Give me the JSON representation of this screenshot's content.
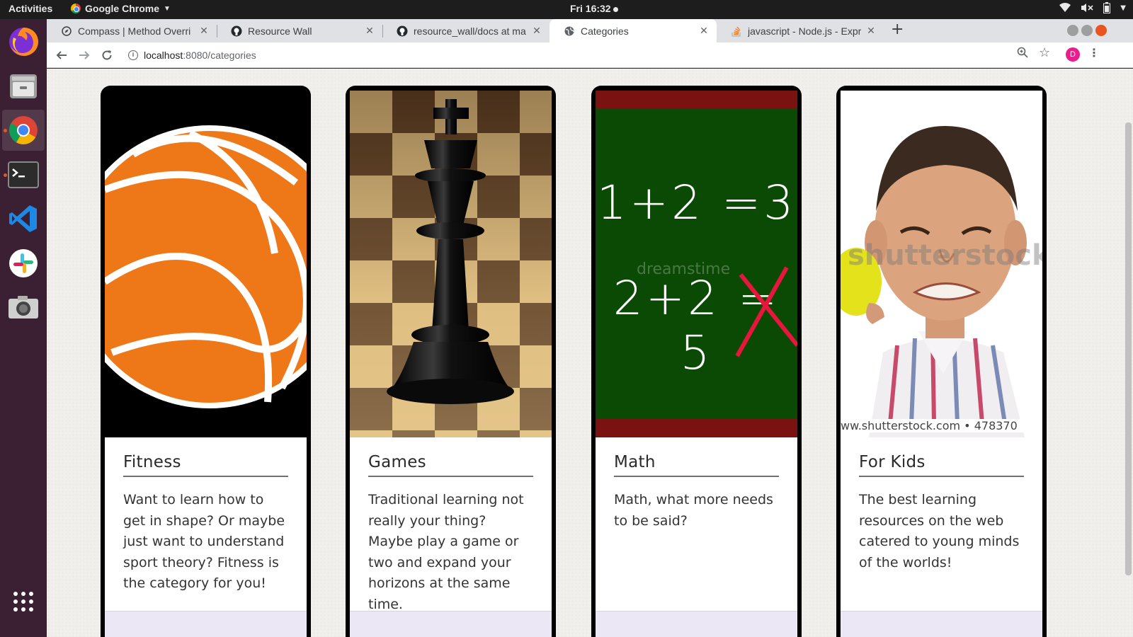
{
  "system": {
    "activities": "Activities",
    "app_name": "Google Chrome",
    "clock": "Fri 16:32"
  },
  "dock": {
    "apps": [
      "firefox-icon",
      "files-icon",
      "chrome-icon",
      "terminal-icon",
      "vscode-icon",
      "slack-icon",
      "screenshot-icon",
      "app-grid-icon"
    ]
  },
  "browser": {
    "tabs": [
      {
        "title": "Compass | Method Overri",
        "icon": "compass-icon"
      },
      {
        "title": "Resource Wall",
        "icon": "github-icon"
      },
      {
        "title": "resource_wall/docs at ma",
        "icon": "github-icon"
      },
      {
        "title": "Categories",
        "icon": "globe-icon"
      },
      {
        "title": "javascript - Node.js - Expr",
        "icon": "stackoverflow-icon"
      }
    ],
    "url_host": "localhost",
    "url_rest": ":8080/categories",
    "profile_initial": "D"
  },
  "page": {
    "categories": [
      {
        "title": "Fitness",
        "description": "Want to learn how to get in shape? Or maybe just want to understand sport theory? Fitness is the category for you!",
        "image": "basketball-image"
      },
      {
        "title": "Games",
        "description": "Traditional learning not really your thing? Maybe play a game or two and expand your horizons at the same time.",
        "image": "chess-king-image"
      },
      {
        "title": "Math",
        "description": "Math, what more needs to be said?",
        "image": "chalkboard-image",
        "chalk_line1": "1+2 =3",
        "chalk_line2": "2+2 = 5",
        "watermark": "dreamstime"
      },
      {
        "title": "For Kids",
        "description": "The best learning resources on the web catered to young minds of the worlds!",
        "image": "kid-lemon-image",
        "watermark": "shutterstock",
        "caption": "ww.shutterstock.com • 478370"
      }
    ]
  }
}
